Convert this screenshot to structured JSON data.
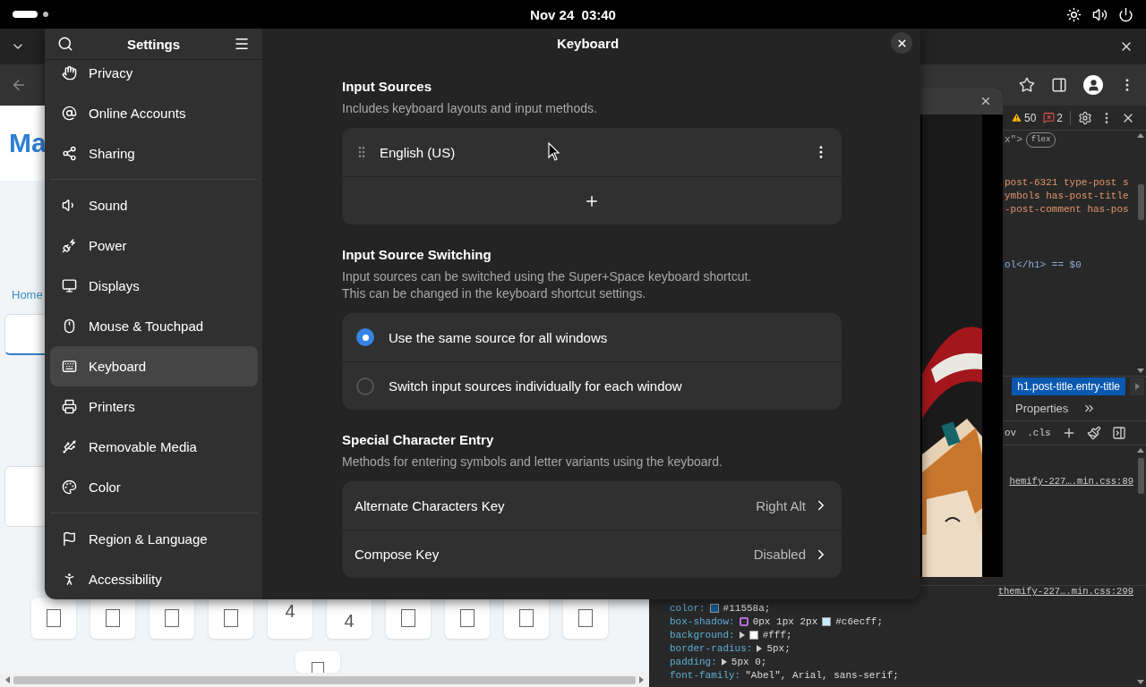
{
  "top_bar": {
    "clock": "Nov 24  03:40"
  },
  "browser": {
    "page": {
      "logo": "Ma",
      "nav_link": "Home",
      "tiles": [
        {
          "kind": "glyph"
        },
        {
          "kind": "glyph"
        },
        {
          "kind": "glyph"
        },
        {
          "kind": "glyph"
        },
        {
          "kind": "top-text",
          "text": "4"
        },
        {
          "kind": "text",
          "text": "4"
        },
        {
          "kind": "glyph"
        },
        {
          "kind": "glyph"
        },
        {
          "kind": "glyph"
        },
        {
          "kind": "glyph"
        }
      ],
      "extra_tile": {
        "kind": "glyph"
      }
    },
    "devtools": {
      "warnings": "50",
      "errors": "2",
      "code_lines": [
        {
          "kind": "badge-line",
          "text": "x\">",
          "badge": "flex"
        },
        {
          "kind": "attr",
          "text": "post-6321 type-post s"
        },
        {
          "kind": "attr",
          "text": "ymbols has-post-title"
        },
        {
          "kind": "attr",
          "text": "-post-comment has-pos"
        },
        {
          "kind": "tag",
          "text": "ol</h1> == $0"
        }
      ],
      "breadcrumb": "h1.post-title.entry-title",
      "tab": "Properties",
      "filter_buttons": [
        "ov",
        ".cls"
      ],
      "sources": [
        "hemify-227….min.css:89",
        "themify-227….min.css:299"
      ],
      "declarations": [
        {
          "property": "color:",
          "parts": [
            {
              "kind": "swatch",
              "color": "#11558a"
            },
            {
              "kind": "text",
              "text": "#11558a;"
            }
          ]
        },
        {
          "property": "box-shadow:",
          "parts": [
            {
              "kind": "shadow-editor"
            },
            {
              "kind": "text",
              "text": "0px 1px 2px"
            },
            {
              "kind": "swatch",
              "color": "#c6ecff"
            },
            {
              "kind": "text",
              "text": "#c6ecff;"
            }
          ]
        },
        {
          "property": "background:",
          "parts": [
            {
              "kind": "expander"
            },
            {
              "kind": "swatch",
              "color": "#ffffff"
            },
            {
              "kind": "text",
              "text": "#fff;"
            }
          ]
        },
        {
          "property": "border-radius:",
          "parts": [
            {
              "kind": "expander"
            },
            {
              "kind": "text",
              "text": "5px;"
            }
          ]
        },
        {
          "property": "padding:",
          "parts": [
            {
              "kind": "expander"
            },
            {
              "kind": "text",
              "text": "5px 0;"
            }
          ]
        },
        {
          "property": "font-family:",
          "parts": [
            {
              "kind": "text",
              "text": "\"Abel\", Arial, sans-serif;"
            }
          ]
        }
      ]
    }
  },
  "settings": {
    "sidebar": {
      "title": "Settings",
      "groups": [
        {
          "items": [
            {
              "label": "Privacy",
              "selected": false
            },
            {
              "label": "Online Accounts",
              "selected": false
            },
            {
              "label": "Sharing",
              "selected": false
            }
          ]
        },
        {
          "items": [
            {
              "label": "Sound",
              "selected": false
            },
            {
              "label": "Power",
              "selected": false
            },
            {
              "label": "Displays",
              "selected": false
            },
            {
              "label": "Mouse & Touchpad",
              "selected": false
            },
            {
              "label": "Keyboard",
              "selected": true
            },
            {
              "label": "Printers",
              "selected": false
            },
            {
              "label": "Removable Media",
              "selected": false
            },
            {
              "label": "Color",
              "selected": false
            }
          ]
        },
        {
          "items": [
            {
              "label": "Region & Language",
              "selected": false
            },
            {
              "label": "Accessibility",
              "selected": false
            }
          ]
        }
      ]
    },
    "page": {
      "title": "Keyboard",
      "sections": [
        {
          "title": "Input Sources",
          "description": "Includes keyboard layouts and input methods.",
          "rows": [
            {
              "kind": "source",
              "label": "English (US)"
            },
            {
              "kind": "add"
            }
          ]
        },
        {
          "title": "Input Source Switching",
          "description": "Input sources can be switched using the Super+Space keyboard shortcut.\nThis can be changed in the keyboard shortcut settings.",
          "rows": [
            {
              "kind": "radio",
              "label": "Use the same source for all windows",
              "selected": true
            },
            {
              "kind": "radio",
              "label": "Switch input sources individually for each window",
              "selected": false
            }
          ]
        },
        {
          "title": "Special Character Entry",
          "description": "Methods for entering symbols and letter variants using the keyboard.",
          "rows": [
            {
              "kind": "link",
              "label": "Alternate Characters Key",
              "value": "Right Alt"
            },
            {
              "kind": "link",
              "label": "Compose Key",
              "value": "Disabled"
            }
          ]
        }
      ]
    }
  }
}
